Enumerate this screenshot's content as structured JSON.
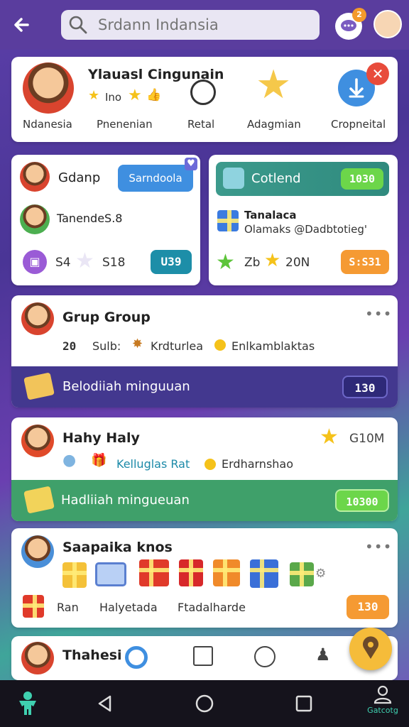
{
  "header": {
    "search_placeholder": "Srdann Indansia",
    "chat_badge": "2"
  },
  "profile_card": {
    "title": "Ylauasl Cingunain",
    "subtitle": "Ino",
    "nav_items": [
      "Ndanesia",
      "Pnenenian",
      "Retal",
      "Adagmian",
      "Cropneital"
    ]
  },
  "left_card": {
    "name": "Gdanp",
    "button": "Sarndoola",
    "second_name": "TanendeS.8",
    "stat1": "S4",
    "stat2": "S18",
    "pill": "U39"
  },
  "right_card": {
    "banner": "Cotlend",
    "banner_value": "1030",
    "title": "Tanalaca",
    "subtitle": "Olamaks @Dadbtotieg'",
    "stat1": "Zb",
    "stat2": "20N",
    "pill": "S:S31"
  },
  "group1": {
    "title": "Grup Group",
    "meta1": "20",
    "meta2": "Sulb:",
    "meta3": "Krdturlea",
    "meta4": "Enlkamblaktas",
    "banner_label": "Belodiiah minguuan",
    "banner_value": "130"
  },
  "group2": {
    "title": "Hahy Haly",
    "value": "G10M",
    "meta1": "Kelluglas Rat",
    "meta2": "Erdharnshao",
    "banner_label": "Hadliiah mingueuan",
    "banner_value": "10300"
  },
  "group3": {
    "title": "Saapaika knos",
    "label1": "Ran",
    "label2": "Halyetada",
    "label3": "Ftadalharde",
    "pill": "130"
  },
  "group4": {
    "title": "Thahesi"
  },
  "system_nav": {
    "right_label": "Gatcotg"
  },
  "colors": {
    "purple_bar": "#43388f",
    "green_bar": "#3fa06a",
    "accent_blue": "#3f8fe0",
    "accent_orange": "#f59a33",
    "accent_green": "#6cd64a"
  }
}
